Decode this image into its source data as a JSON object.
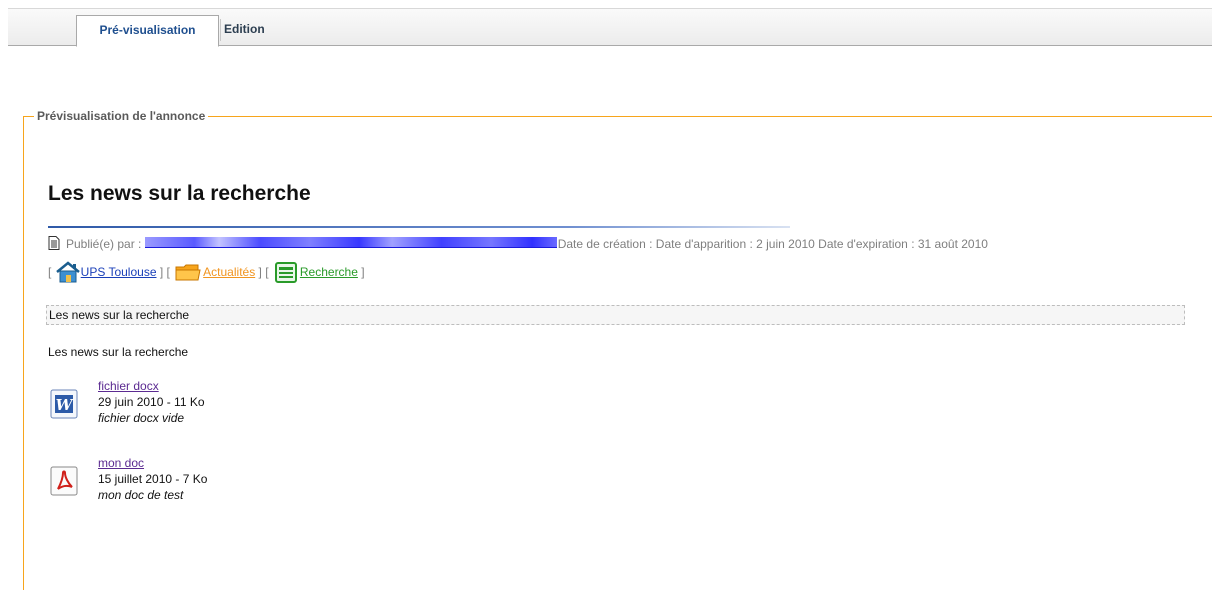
{
  "tabs": {
    "preview_label": "Pré-visualisation",
    "edit_label": "Edition"
  },
  "panel": {
    "legend": "Prévisualisation de l'annonce"
  },
  "announcement": {
    "title": "Les news sur la recherche",
    "published_by_label": "Publié(e) par :",
    "dates_text": "Date de création : Date d'apparition : 2 juin 2010 Date d'expiration : 31 août 2010",
    "categories": [
      {
        "name": "UPS Toulouse",
        "icon": "home-icon",
        "color": "#1a3fb8"
      },
      {
        "name": "Actualités",
        "icon": "folder-icon",
        "color": "#f19520"
      },
      {
        "name": "Recherche",
        "icon": "notebook-icon",
        "color": "#2a9b2a"
      }
    ],
    "summary": "Les news sur la recherche",
    "body": "Les news sur la recherche"
  },
  "attachments": [
    {
      "name": "fichier docx",
      "info": "29 juin 2010 - 11 Ko",
      "description": "fichier docx vide",
      "icon": "word-document-icon"
    },
    {
      "name": "mon doc",
      "info": "15 juillet 2010 - 7 Ko",
      "description": "mon doc de test",
      "icon": "pdf-document-icon"
    }
  ],
  "colors": {
    "panel_border": "#f7a51c",
    "active_tab_text": "#1f4f8f",
    "title_rule": "#2f5aa8"
  }
}
